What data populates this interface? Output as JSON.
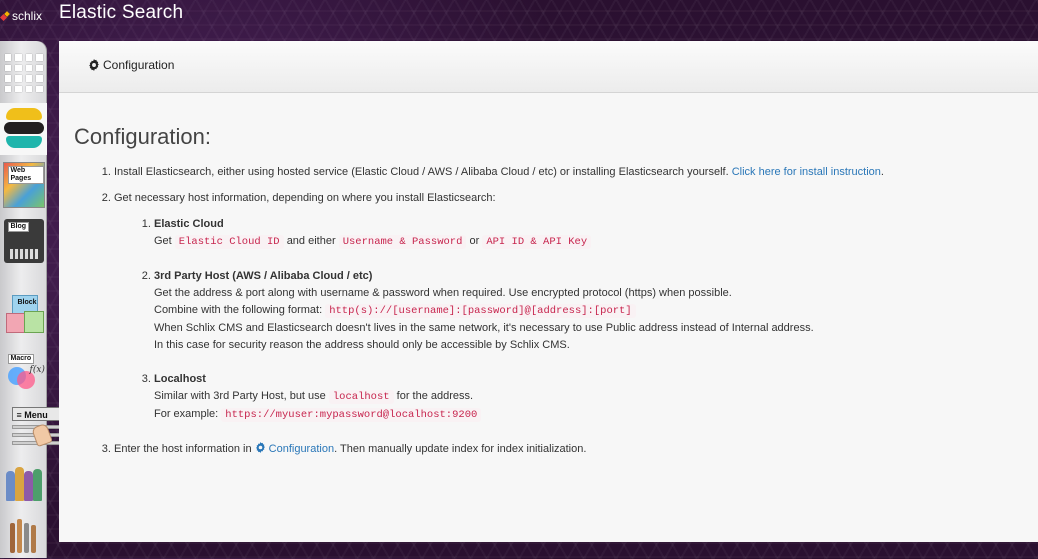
{
  "app": {
    "logo_text": "schlix",
    "title": "Elastic Search"
  },
  "dock": {
    "items": [
      {
        "name": "apps-grid"
      },
      {
        "name": "elastic-search",
        "active": true
      },
      {
        "name": "web-pages",
        "label": "Web Pages"
      },
      {
        "name": "blog",
        "label": "Blog"
      },
      {
        "name": "block",
        "label": "Block"
      },
      {
        "name": "macro",
        "label": "Macro",
        "sublabel": "f(x)"
      },
      {
        "name": "menu",
        "label": "≡ Menu"
      },
      {
        "name": "users"
      },
      {
        "name": "tools"
      }
    ]
  },
  "toolbar": {
    "config_button": "Configuration"
  },
  "main": {
    "heading": "Configuration:",
    "step1": {
      "text": "Install Elasticsearch, either using hosted service (Elastic Cloud / AWS / Alibaba Cloud / etc) or installing Elasticsearch yourself.",
      "link": "Click here for install instruction",
      "suffix": "."
    },
    "step2": {
      "text": "Get necessary host information, depending on where you install Elasticsearch:",
      "elastic_cloud": {
        "title": "Elastic Cloud",
        "get": "Get",
        "code1": "Elastic Cloud ID",
        "and_either": "and either",
        "code2": "Username & Password",
        "or": "or",
        "code3": "API ID & API Key"
      },
      "third_party": {
        "title": "3rd Party Host (AWS / Alibaba Cloud / etc)",
        "line1": "Get the address & port along with username & password when required. Use encrypted protocol (https) when possible.",
        "line2_prefix": "Combine with the following format:",
        "format_code": "http(s)://[username]:[password]@[address]:[port]",
        "line3": "When Schlix CMS and Elasticsearch doesn't lives in the same network, it's necessary to use Public address instead of Internal address.",
        "line4": "In this case for security reason the address should only be accessible by Schlix CMS."
      },
      "localhost": {
        "title": "Localhost",
        "line1_prefix": "Similar with 3rd Party Host, but use",
        "code": "localhost",
        "line1_suffix": "for the address.",
        "line2_prefix": "For example:",
        "example_code": "https://myuser:mypassword@localhost:9200"
      }
    },
    "step3": {
      "prefix": "Enter the host information in",
      "link": "Configuration",
      "suffix": ". Then manually update index for index initialization."
    }
  },
  "colors": {
    "link": "#2a77b8",
    "code_text": "#c7254e",
    "code_bg": "#f9f2f4",
    "panel_bg": "#f7f7f7",
    "dock_active": "#f7f7f7"
  }
}
